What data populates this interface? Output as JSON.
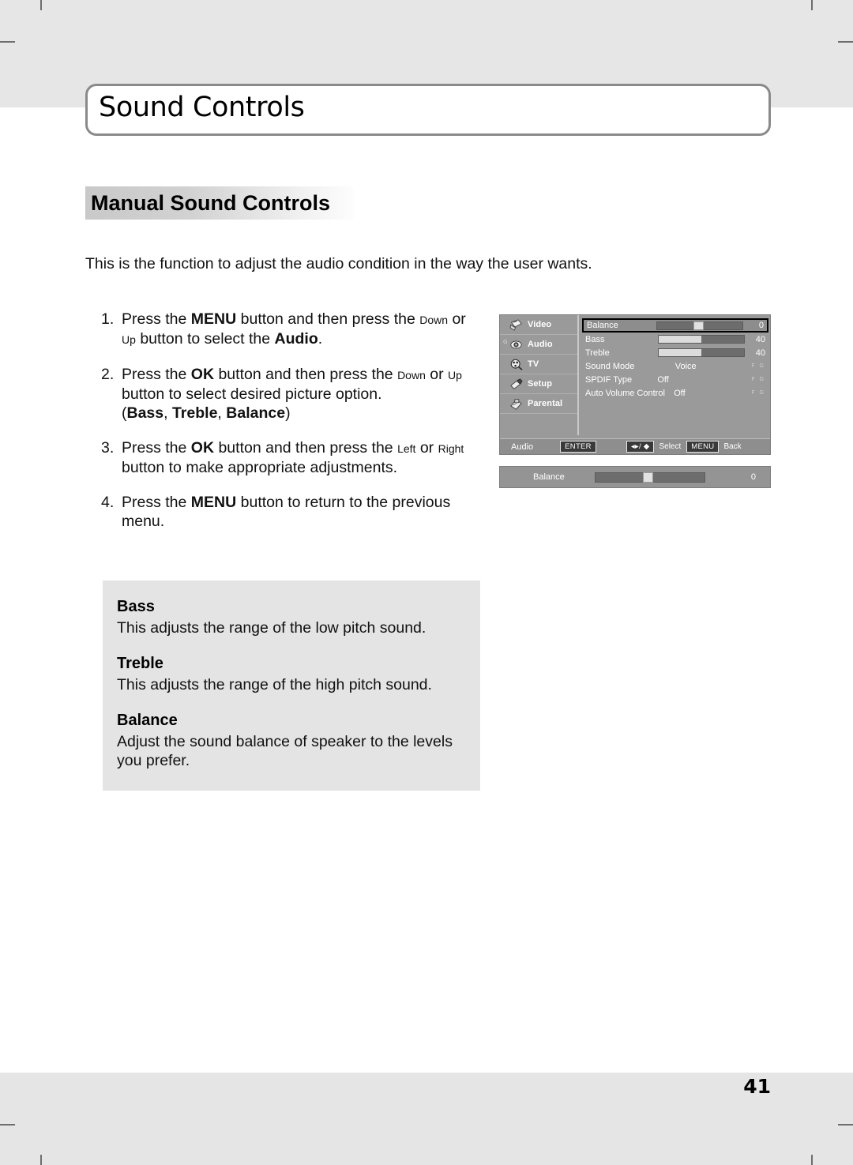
{
  "page": {
    "chapter_title": "Sound Controls",
    "section_heading": "Manual Sound Controls",
    "intro": "This is the function to adjust the audio condition in the way the user wants.",
    "page_number": "41"
  },
  "steps": [
    {
      "num": "1.",
      "parts": [
        {
          "t": "Press the ",
          "style": "normal"
        },
        {
          "t": "MENU",
          "style": "bold"
        },
        {
          "t": " button and then press the ",
          "style": "normal"
        },
        {
          "t": "Down",
          "style": "small"
        },
        {
          "t": " or ",
          "style": "normal"
        },
        {
          "t": "Up",
          "style": "small"
        },
        {
          "t": " button to select the ",
          "style": "normal"
        },
        {
          "t": "Audio",
          "style": "bold"
        },
        {
          "t": ".",
          "style": "normal"
        }
      ]
    },
    {
      "num": "2.",
      "parts": [
        {
          "t": "Press the ",
          "style": "normal"
        },
        {
          "t": "OK",
          "style": "bold"
        },
        {
          "t": " button and then press the ",
          "style": "normal"
        },
        {
          "t": "Down",
          "style": "small"
        },
        {
          "t": " or ",
          "style": "normal"
        },
        {
          "t": "Up",
          "style": "small"
        },
        {
          "t": " button to select desired picture option.",
          "style": "normal"
        },
        {
          "t": "\n",
          "style": "break"
        },
        {
          "t": "(",
          "style": "normal"
        },
        {
          "t": "Bass",
          "style": "bold"
        },
        {
          "t": ", ",
          "style": "normal"
        },
        {
          "t": "Treble",
          "style": "bold"
        },
        {
          "t": ", ",
          "style": "normal"
        },
        {
          "t": "Balance",
          "style": "bold"
        },
        {
          "t": ")",
          "style": "normal"
        }
      ]
    },
    {
      "num": "3.",
      "parts": [
        {
          "t": "Press the ",
          "style": "normal"
        },
        {
          "t": "OK",
          "style": "bold"
        },
        {
          "t": " button and then press the ",
          "style": "normal"
        },
        {
          "t": "Left",
          "style": "small"
        },
        {
          "t": " or ",
          "style": "normal"
        },
        {
          "t": "Right",
          "style": "small"
        },
        {
          "t": " button to make appropriate adjustments.",
          "style": "normal"
        }
      ]
    },
    {
      "num": "4.",
      "parts": [
        {
          "t": "Press the ",
          "style": "normal"
        },
        {
          "t": "MENU",
          "style": "bold"
        },
        {
          "t": " button to return to the previous menu.",
          "style": "normal"
        }
      ]
    }
  ],
  "osd": {
    "sidebar": [
      {
        "label": "Video",
        "icon": "video-icon",
        "pre_glyph": ""
      },
      {
        "label": "Audio",
        "icon": "audio-icon",
        "pre_glyph": "G"
      },
      {
        "label": "TV",
        "icon": "tv-icon",
        "pre_glyph": ""
      },
      {
        "label": "Setup",
        "icon": "setup-icon",
        "pre_glyph": ""
      },
      {
        "label": "Parental",
        "icon": "parental-icon",
        "pre_glyph": ""
      }
    ],
    "rows": [
      {
        "label": "Balance",
        "kind": "slider",
        "value": "0",
        "fill_pct": 0,
        "thumb_pct": 48,
        "selected": true
      },
      {
        "label": "Bass",
        "kind": "slider",
        "value": "40",
        "fill_pct": 50,
        "thumb_pct": -1,
        "selected": false
      },
      {
        "label": "Treble",
        "kind": "slider",
        "value": "40",
        "fill_pct": 50,
        "thumb_pct": -1,
        "selected": false
      },
      {
        "label": "Sound Mode",
        "kind": "option",
        "value": "Voice",
        "arrows": "F G",
        "selected": false
      },
      {
        "label": "SPDIF Type",
        "kind": "option",
        "value": "Off",
        "arrows": "F G",
        "selected": false
      },
      {
        "label": "Auto Volume Control",
        "kind": "option",
        "value": "Off",
        "arrows": "F G",
        "selected": false
      }
    ],
    "footer": {
      "title": "Audio",
      "enter_key": "ENTER",
      "dpad_glyph": "◂▸/ ◆",
      "select_label": "Select",
      "menu_key": "MENU",
      "back_label": "Back"
    }
  },
  "balance_bar": {
    "label": "Balance",
    "value": "0",
    "thumb_pct": 48
  },
  "definitions": [
    {
      "term": "Bass",
      "desc": "This adjusts the range of the low pitch sound."
    },
    {
      "term": "Treble",
      "desc": "This adjusts the range of the high pitch sound."
    },
    {
      "term": "Balance",
      "desc": "Adjust the sound balance of speaker to the levels you prefer."
    }
  ],
  "colors": {
    "page_band": "#e6e6e6",
    "osd_background": "#9a9a9a",
    "osd_footer": "#8e8e8e",
    "slider_track": "#6d6d6d",
    "slider_fill": "#dcdcdc",
    "definitions_box": "#e4e4e4"
  }
}
